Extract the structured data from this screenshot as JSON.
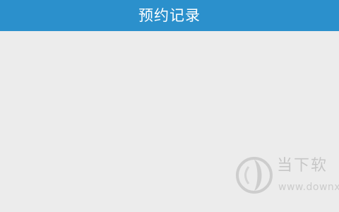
{
  "header": {
    "title": "预约记录"
  },
  "watermark": {
    "title": "当下软",
    "url": "www.downx"
  },
  "colors": {
    "header_background": "#2b90cc",
    "page_background": "#ececec",
    "header_text": "#ffffff"
  },
  "icons": {
    "watermark_logo": "downxia-logo-icon"
  }
}
